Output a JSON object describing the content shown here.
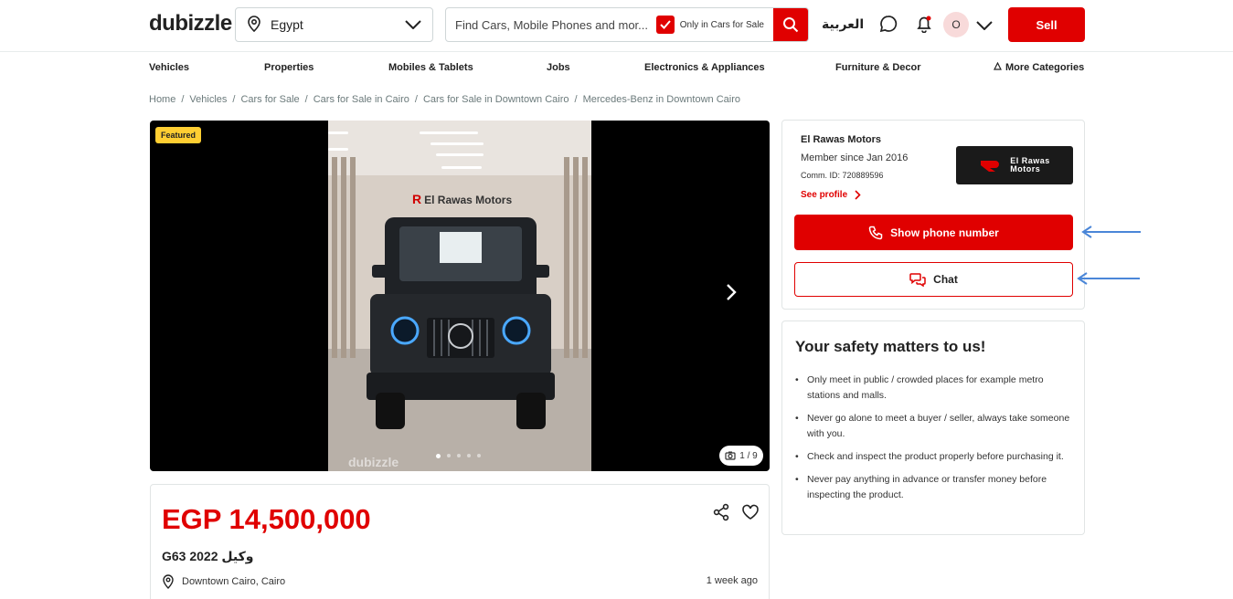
{
  "header": {
    "logo": "dubizzle",
    "location": "Egypt",
    "search_placeholder": "Find Cars, Mobile Phones and mor...",
    "only_in_label": "Only in Cars for Sale",
    "language": "العربية",
    "avatar_initial": "O",
    "sell_label": "Sell"
  },
  "nav": {
    "items": [
      "Vehicles",
      "Properties",
      "Mobiles & Tablets",
      "Jobs",
      "Electronics & Appliances",
      "Furniture & Decor"
    ],
    "more": "More Categories"
  },
  "breadcrumb": [
    "Home",
    "Vehicles",
    "Cars for Sale",
    "Cars for Sale in Cairo",
    "Cars for Sale in Downtown Cairo",
    "Mercedes-Benz in Downtown Cairo"
  ],
  "gallery": {
    "badge": "Featured",
    "counter": "1 / 9",
    "photo_sign": "El Rawas Motors",
    "watermark": "dubizzle"
  },
  "listing": {
    "price": "EGP 14,500,000",
    "title": "G63 2022 وكيل",
    "location": "Downtown Cairo, Cairo",
    "posted": "1 week ago"
  },
  "seller": {
    "name": "El Rawas Motors",
    "member_since": "Member since Jan 2016",
    "comm_id": "Comm. ID: 720889596",
    "see_profile": "See profile",
    "logo_line1": "El Rawas",
    "logo_line2": "Motors",
    "phone_button": "Show phone number",
    "chat_button": "Chat"
  },
  "safety": {
    "title": "Your safety matters to us!",
    "tips": [
      "Only meet in public / crowded places for example metro stations and malls.",
      "Never go alone to meet a buyer / seller, always take someone with you.",
      "Check and inspect the product properly before purchasing it.",
      "Never pay anything in advance or transfer money before inspecting the product."
    ]
  },
  "colors": {
    "brand_red": "#e00000",
    "featured_yellow": "#ffce32",
    "annotation_arrow": "#4a86d8"
  }
}
